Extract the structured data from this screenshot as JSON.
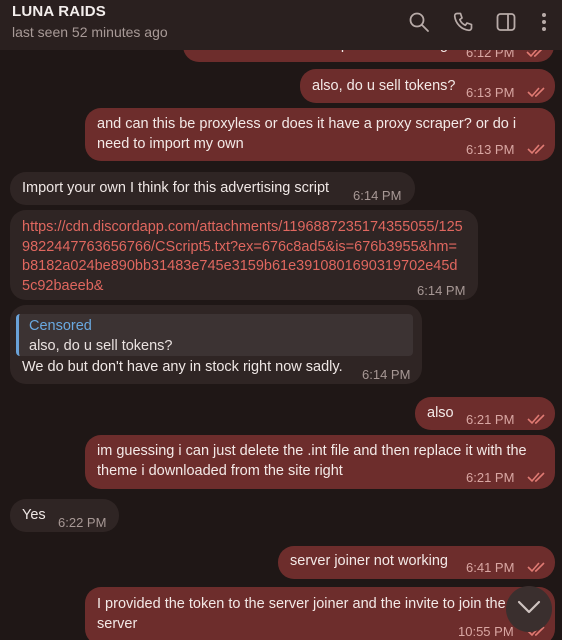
{
  "header": {
    "title": "LUNA RAIDS",
    "status": "last seen 52 minutes ago"
  },
  "messages": [
    {
      "id": "m0",
      "direction": "out",
      "text": "can u send me the script for advertising",
      "time": "6:12 PM"
    },
    {
      "id": "m1",
      "direction": "out",
      "text": "also, do u sell tokens?",
      "time": "6:13 PM"
    },
    {
      "id": "m2",
      "direction": "out",
      "text": "and can this be proxyless or does it have a proxy scraper? or do i need to import my own",
      "time": "6:13 PM"
    },
    {
      "id": "m3",
      "direction": "in",
      "text": "Import your own I think for this advertising script",
      "time": "6:14 PM"
    },
    {
      "id": "m4",
      "direction": "in",
      "link": "https://cdn.discordapp.com/attachments/1196887235174355055/1259822447763656766/CScript5.txt?ex=676c8ad5&is=676b3955&hm=b8182a024be890bb31483e745e3159b61e3910801690319702e45d5c92baeeb&",
      "time": "6:14 PM"
    },
    {
      "id": "m5",
      "direction": "in",
      "reply": {
        "name": "Censored",
        "text": "also, do u sell tokens?"
      },
      "text": "We do but don't have any in stock right now sadly.",
      "time": "6:14 PM"
    },
    {
      "id": "m6",
      "direction": "out",
      "text": "also",
      "time": "6:21 PM"
    },
    {
      "id": "m7",
      "direction": "out",
      "text": "im guessing i can just delete the .int file and then replace it with the theme i downloaded from the site right",
      "time": "6:21 PM"
    },
    {
      "id": "m8",
      "direction": "in",
      "text": "Yes",
      "time": "6:22 PM"
    },
    {
      "id": "m9",
      "direction": "out",
      "text": "server joiner not working",
      "time": "6:41 PM"
    },
    {
      "id": "m10",
      "direction": "out",
      "text": "I provided the token to the server joiner and the invite to join the server",
      "time": "10:55 PM"
    }
  ],
  "icons": {
    "search": "search-icon",
    "call": "phone-icon",
    "sidebar": "sidebar-toggle-icon",
    "menu": "more-vertical-icon",
    "read": "double-check-icon",
    "scroll": "chevron-down-icon"
  },
  "colors": {
    "outgoing_bubble": "#6d2d2c",
    "incoming_bubble": "#2f2524",
    "background": "#1f1716",
    "link": "#e0675f",
    "reply_accent": "#6aa2d8"
  }
}
